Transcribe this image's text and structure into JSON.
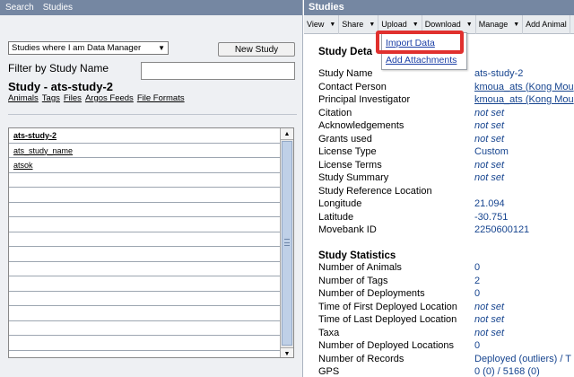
{
  "topnav": {
    "search": "Search",
    "studies": "Studies"
  },
  "left": {
    "select_value": "Studies where I am Data Manager",
    "new_study": "New Study",
    "filter_label": "Filter by Study Name",
    "filter_value": "",
    "study_title": "Study - ats-study-2",
    "sublinks": [
      "Animals",
      "Tags",
      "Files",
      "Argos Feeds",
      "File Formats"
    ],
    "list_rows": [
      "ats-study-2",
      "ats_study_name",
      "atsok",
      "",
      "",
      "",
      "",
      "",
      "",
      "",
      "",
      "",
      "",
      "",
      ""
    ]
  },
  "right": {
    "header": "Studies",
    "toolbar": [
      "View",
      "Share",
      "Upload",
      "Download",
      "Manage",
      "Add Animal"
    ],
    "dropdown": {
      "import": "Import Data",
      "attachments": "Add Attachments"
    },
    "section1": "Study Deta",
    "details": [
      {
        "k": "Study Name",
        "v": "ats-study-2",
        "style": "plain"
      },
      {
        "k": "Contact Person",
        "v": "kmoua_ats (Kong Mou",
        "style": "link"
      },
      {
        "k": "Principal Investigator",
        "v": "kmoua_ats (Kong Mou",
        "style": "link"
      },
      {
        "k": "Citation",
        "v": "not set",
        "style": "italic"
      },
      {
        "k": "Acknowledgements",
        "v": "not set",
        "style": "italic"
      },
      {
        "k": "Grants used",
        "v": "not set",
        "style": "italic"
      },
      {
        "k": "License Type",
        "v": "Custom",
        "style": "plain"
      },
      {
        "k": "License Terms",
        "v": "not set",
        "style": "italic"
      },
      {
        "k": "Study Summary",
        "v": "not set",
        "style": "italic"
      },
      {
        "k": "Study Reference Location",
        "v": "",
        "style": "plain"
      },
      {
        "k": "Longitude",
        "v": "21.094",
        "style": "plain"
      },
      {
        "k": "Latitude",
        "v": "-30.751",
        "style": "plain"
      },
      {
        "k": "Movebank ID",
        "v": "2250600121",
        "style": "plain"
      }
    ],
    "section2": "Study Statistics",
    "stats": [
      {
        "k": "Number of Animals",
        "v": "0",
        "style": "plain"
      },
      {
        "k": "Number of Tags",
        "v": "2",
        "style": "plain"
      },
      {
        "k": "Number of Deployments",
        "v": "0",
        "style": "plain"
      },
      {
        "k": "Time of First Deployed Location",
        "v": "not set",
        "style": "italic"
      },
      {
        "k": "Time of Last Deployed Location",
        "v": "not set",
        "style": "italic"
      },
      {
        "k": "Taxa",
        "v": "not set",
        "style": "italic"
      },
      {
        "k": "Number of Deployed Locations",
        "v": "0",
        "style": "plain"
      },
      {
        "k": "Number of Records",
        "v": "Deployed (outliers) / T",
        "style": "plain"
      },
      {
        "k": "  GPS",
        "v": "0 (0) / 5168 (0)",
        "style": "plain"
      }
    ]
  }
}
